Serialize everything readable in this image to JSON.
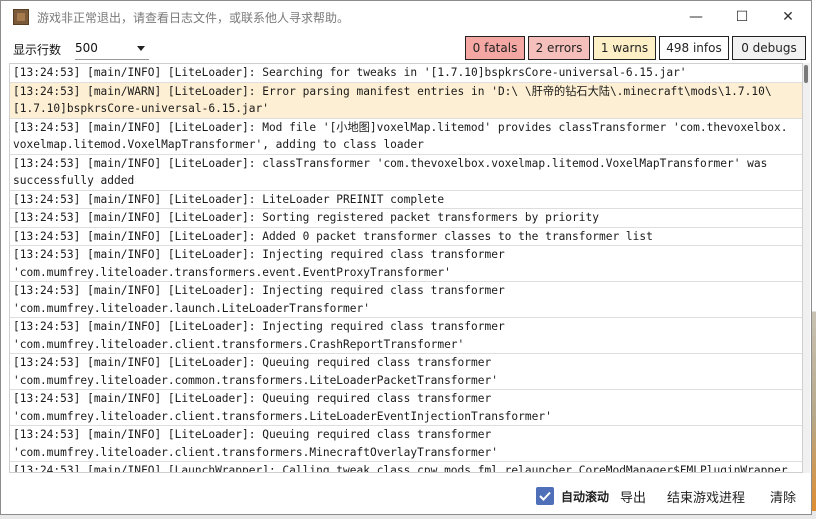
{
  "window": {
    "title": "游戏非正常退出，请查看日志文件，或联系他人寻求帮助。",
    "controls": {
      "minimize": "—",
      "maximize": "☐",
      "close": "✕"
    }
  },
  "toolbar": {
    "rows_label": "显示行数",
    "rows_value": "500",
    "filters": {
      "fatals": "0 fatals",
      "errors": "2 errors",
      "warns": "1 warns",
      "infos": "498 infos",
      "debugs": "0 debugs"
    },
    "colors": {
      "fatal": "#f4a7a3",
      "error": "#f5c0bb",
      "warn": "#fdf0c7",
      "accent": "#4f6fb8"
    }
  },
  "log": {
    "lines": [
      {
        "level": "info",
        "text": "[13:24:53] [main/INFO] [LiteLoader]: Searching for tweaks in '[1.7.10]bspkrsCore-universal-6.15.jar'"
      },
      {
        "level": "warn",
        "text": "[13:24:53] [main/WARN] [LiteLoader]: Error parsing manifest entries in 'D:\\ \\肝帝的钻石大陆\\.minecraft\\mods\\1.7.10\\\n[1.7.10]bspkrsCore-universal-6.15.jar'"
      },
      {
        "level": "info",
        "text": "[13:24:53] [main/INFO] [LiteLoader]: Mod file '[小地图]voxelMap.litemod' provides classTransformer 'com.thevoxelbox.\nvoxelmap.litemod.VoxelMapTransformer', adding to class loader"
      },
      {
        "level": "info",
        "text": "[13:24:53] [main/INFO] [LiteLoader]: classTransformer 'com.thevoxelbox.voxelmap.litemod.VoxelMapTransformer' was\nsuccessfully added"
      },
      {
        "level": "info",
        "text": "[13:24:53] [main/INFO] [LiteLoader]: LiteLoader PREINIT complete"
      },
      {
        "level": "info",
        "text": "[13:24:53] [main/INFO] [LiteLoader]: Sorting registered packet transformers by priority"
      },
      {
        "level": "info",
        "text": "[13:24:53] [main/INFO] [LiteLoader]: Added 0 packet transformer classes to the transformer list"
      },
      {
        "level": "info",
        "text": "[13:24:53] [main/INFO] [LiteLoader]: Injecting required class transformer\n'com.mumfrey.liteloader.transformers.event.EventProxyTransformer'"
      },
      {
        "level": "info",
        "text": "[13:24:53] [main/INFO] [LiteLoader]: Injecting required class transformer\n'com.mumfrey.liteloader.launch.LiteLoaderTransformer'"
      },
      {
        "level": "info",
        "text": "[13:24:53] [main/INFO] [LiteLoader]: Injecting required class transformer\n'com.mumfrey.liteloader.client.transformers.CrashReportTransformer'"
      },
      {
        "level": "info",
        "text": "[13:24:53] [main/INFO] [LiteLoader]: Queuing required class transformer\n'com.mumfrey.liteloader.common.transformers.LiteLoaderPacketTransformer'"
      },
      {
        "level": "info",
        "text": "[13:24:53] [main/INFO] [LiteLoader]: Queuing required class transformer\n'com.mumfrey.liteloader.client.transformers.LiteLoaderEventInjectionTransformer'"
      },
      {
        "level": "info",
        "text": "[13:24:53] [main/INFO] [LiteLoader]: Queuing required class transformer\n'com.mumfrey.liteloader.client.transformers.MinecraftOverlayTransformer'"
      },
      {
        "level": "info",
        "text": "[13:24:53] [main/INFO] [LaunchWrapper]: Calling tweak class cpw.mods.fml.relauncher.CoreModManager$FMLPluginWrapper"
      }
    ]
  },
  "bottom": {
    "auto_scroll_label": "自动滚动",
    "auto_scroll_checked": true,
    "export_label": "导出",
    "kill_label": "结束游戏进程",
    "clear_label": "清除"
  }
}
